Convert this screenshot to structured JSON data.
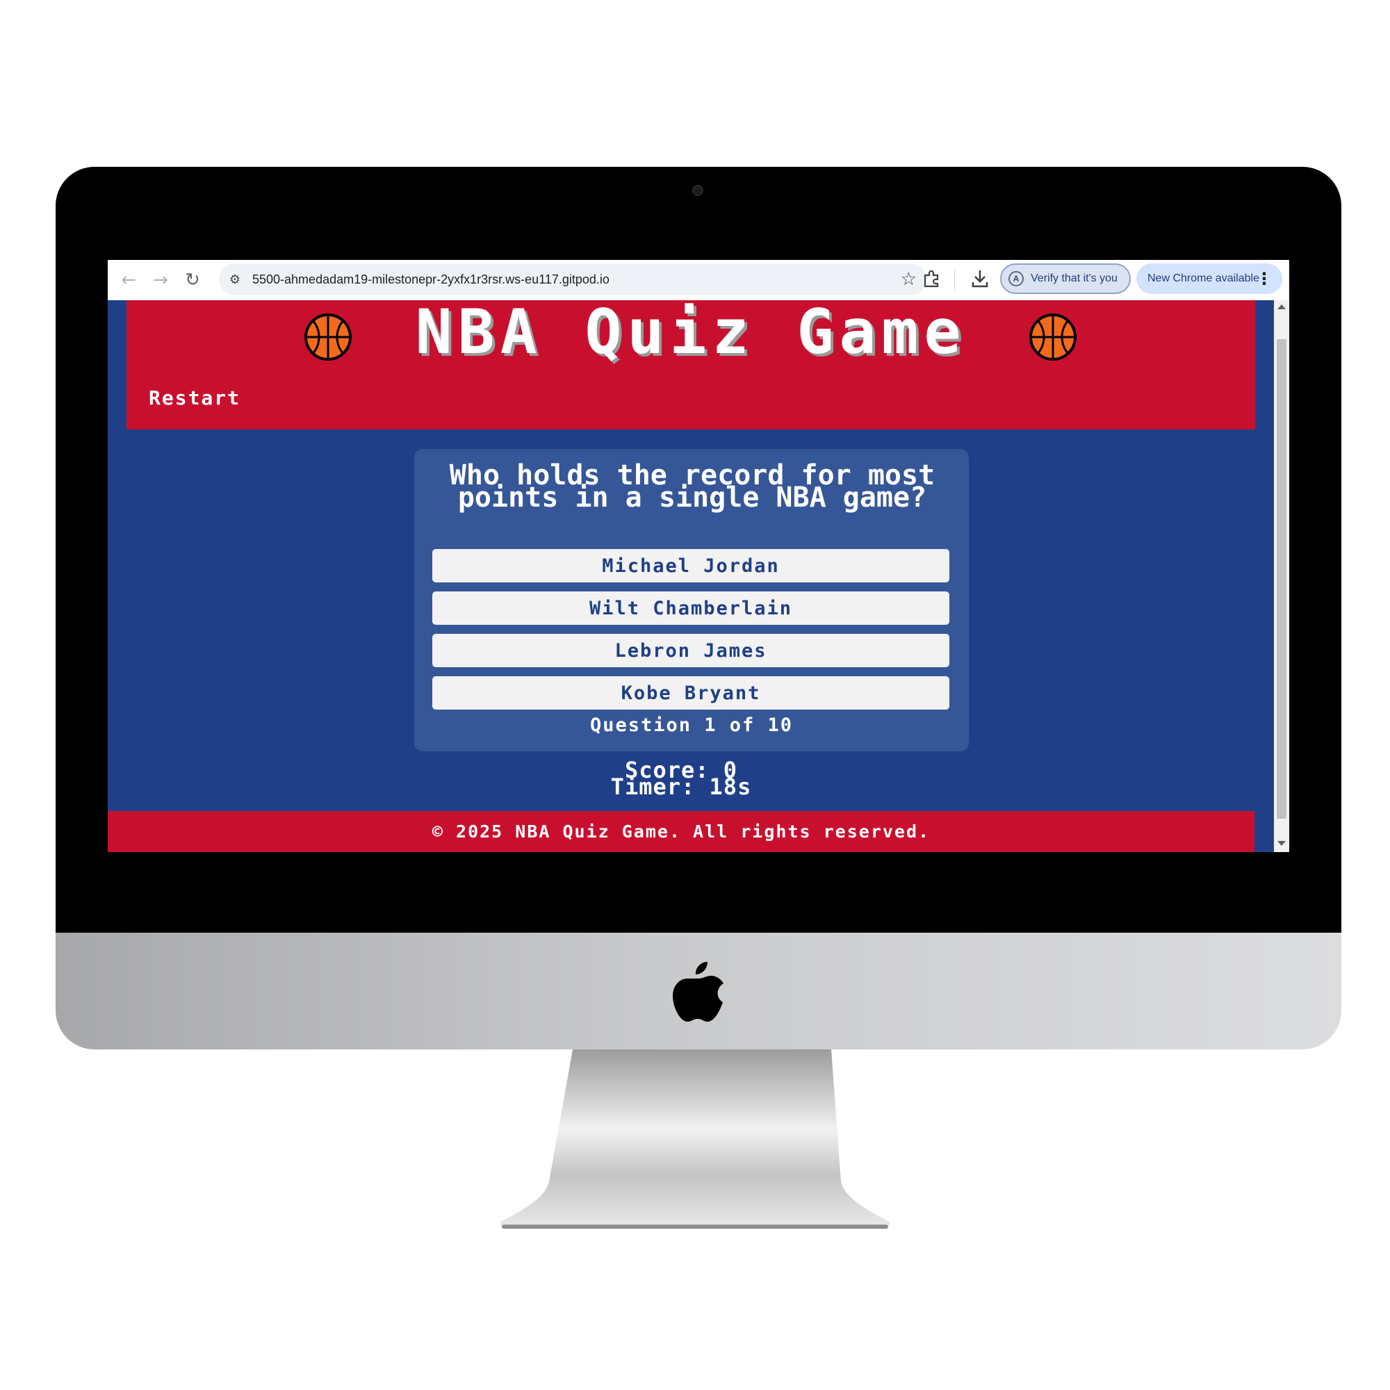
{
  "browser": {
    "url": "5500-ahmedadam19-milestonepr-2yxfx1r3rsr.ws-eu117.gitpod.io",
    "verify_chip": "Verify that it's you",
    "verify_avatar_letter": "A",
    "update_chip": "New Chrome available"
  },
  "page": {
    "title": "NBA Quiz Game",
    "restart_label": "Restart",
    "question": "Who holds the record for most points in a single NBA game?",
    "answers": [
      "Michael Jordan",
      "Wilt Chamberlain",
      "Lebron James",
      "Kobe Bryant"
    ],
    "progress": "Question 1 of 10",
    "score": "Score: 0",
    "timer": "Timer: 18s",
    "footer": "© 2025 NBA Quiz Game. All rights reserved."
  },
  "colors": {
    "header_red": "#c8102e",
    "page_blue": "#1f4088",
    "card_blue": "#365797",
    "answer_bg": "#f2f2f2"
  },
  "icons": [
    "back-icon",
    "forward-icon",
    "reload-icon",
    "site-settings-icon",
    "bookmark-star-icon",
    "extensions-icon",
    "download-icon",
    "menu-dots-icon",
    "basketball-icon",
    "apple-logo-icon"
  ]
}
